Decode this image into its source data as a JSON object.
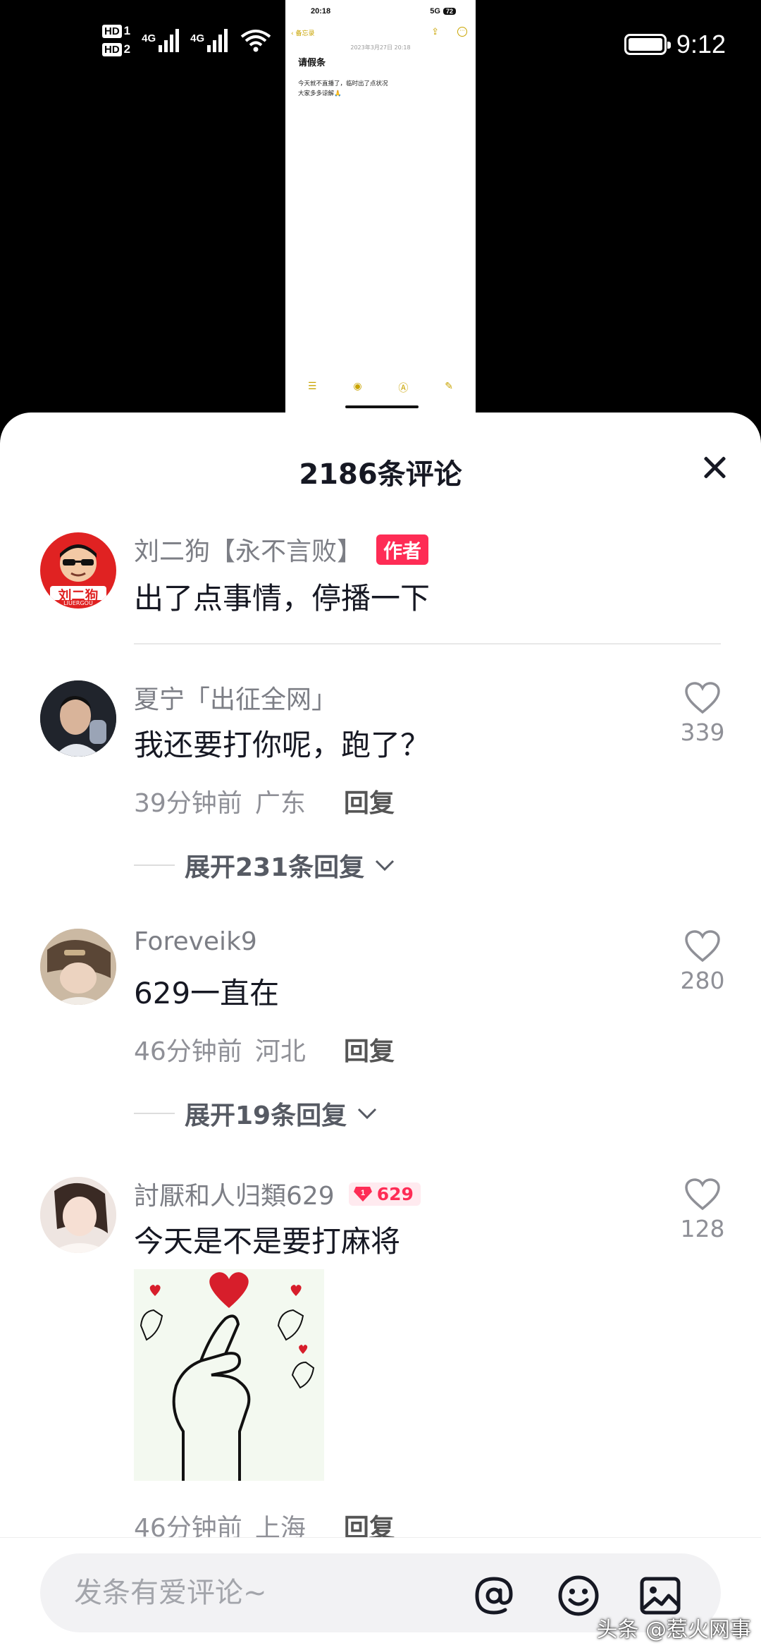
{
  "status_bar": {
    "sim1": "1",
    "sim2": "2",
    "net1": "4G",
    "net2": "4G",
    "time": "9:12"
  },
  "embedded_note": {
    "status_time": "20:18",
    "status_net": "5G",
    "status_battery": "72",
    "back_label": "备忘录",
    "date": "2023年3月27日 20:18",
    "title": "请假条",
    "line1": "今天就不直播了，临时出了点状况",
    "line2": "大家多多谅解🙏"
  },
  "sheet": {
    "title": "2186条评论"
  },
  "comments": [
    {
      "name": "刘二狗【永不言败】",
      "badge": "作者",
      "text": "出了点事情，停播一下",
      "avatar_text": "刘二狗",
      "avatar_sub": "LIUERGOU"
    },
    {
      "name": "夏宁「出征全网」",
      "text": "我还要打你呢，跑了？",
      "time": "39分钟前",
      "location": "广东",
      "reply": "回复",
      "likes": "339",
      "expand": "展开231条回复"
    },
    {
      "name": "Foreveik9",
      "text": "629一直在",
      "time": "46分钟前",
      "location": "河北",
      "reply": "回复",
      "likes": "280",
      "expand": "展开19条回复"
    },
    {
      "name": "討厭和人归類629",
      "fan_level": "1",
      "fan_value": "629",
      "text": "今天是不是要打麻将",
      "time": "46分钟前",
      "location": "上海",
      "reply": "回复",
      "likes": "128"
    }
  ],
  "input": {
    "placeholder": "发条有爱评论~"
  },
  "watermark": "头条 @惹火网事",
  "colors": {
    "accent": "#fe2c55",
    "text_primary": "#161823",
    "text_secondary": "#8f9097",
    "notes_accent": "#c9a400"
  }
}
